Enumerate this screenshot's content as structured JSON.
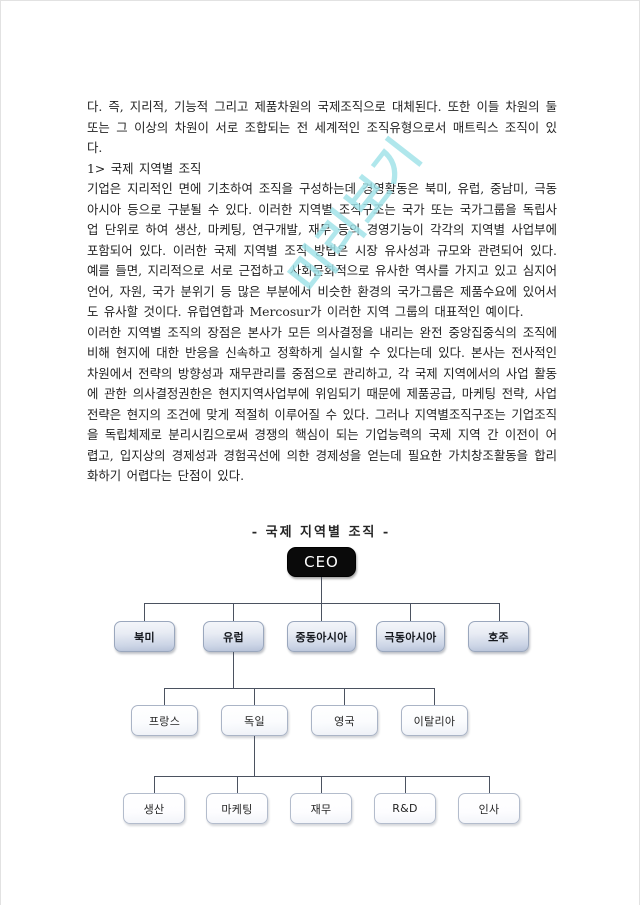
{
  "document": {
    "paragraphs": [
      {
        "id": "intro",
        "text": "다. 즉, 지리적, 기능적 그리고 제품차원의 국제조직으로 대체된다. 또한 이들 차원의 둘 또는 그 이상의 차원이 서로 조합되는 전 세계적인 조직유형으로서 매트릭스 조직이 있다."
      },
      {
        "id": "section-heading",
        "text": "1> 국제 지역별 조직"
      },
      {
        "id": "body-1",
        "text": "기업은 지리적인 면에 기초하여 조직을 구성하는데 경영활동은 북미, 유럽, 중남미, 극동아시아 등으로 구분될 수 있다. 이러한 지역별 조직구조는 국가 또는 국가그룹을 독립사업 단위로 하여 생산, 마케팅, 연구개발, 재무 등의 경영기능이 각각의 지역별 사업부에 포함되어 있다. 이러한 국제 지역별 조직 방법은 시장 유사성과 규모와 관련되어 있다. 예를 들면, 지리적으로 서로 근접하고 사회문화적으로 유사한 역사를 가지고 있고 심지어 언어, 자원, 국가 분위기 등 많은 부분에서 비슷한 환경의 국가그룹은 제품수요에 있어서도 유사할 것이다. 유럽연합과 Mercosur가 이러한 지역 그룹의 대표적인 예이다."
      },
      {
        "id": "body-2",
        "text": "이러한 지역별 조직의 장점은 본사가 모든 의사결정을 내리는 완전 중앙집중식의 조직에 비해 현지에 대한 반응을 신속하고 정확하게 실시할 수 있다는데 있다. 본사는 전사적인 차원에서 전략의 방향성과 재무관리를 중점으로 관리하고, 각 국제 지역에서의 사업 활동에 관한 의사결정권한은 현지지역사업부에 위임되기 때문에 제품공급, 마케팅 전략, 사업전략은 현지의 조건에 맞게 적절히 이루어질 수 있다. 그러나 지역별조직구조는 기업조직을 독립체제로 분리시킴으로써 경쟁의 핵심이 되는 기업능력의 국제 지역 간 이전이 어렵고, 입지상의 경제성과 경험곡선에 의한 경제성을 얻는데 필요한 가치창조활동을 합리화하기 어렵다는 단점이 있다."
      }
    ]
  },
  "watermark": {
    "text": "미리보기",
    "color": "#9fe2e8"
  },
  "chart": {
    "title": "- 국제 지역별 조직 -",
    "root": {
      "label": "CEO"
    },
    "regions": [
      {
        "label": "북미"
      },
      {
        "label": "유럽"
      },
      {
        "label": "중동아시아"
      },
      {
        "label": "극동아시아"
      },
      {
        "label": "호주"
      }
    ],
    "countries": [
      {
        "label": "프랑스"
      },
      {
        "label": "독일"
      },
      {
        "label": "영국"
      },
      {
        "label": "이탈리아"
      }
    ],
    "functions": [
      {
        "label": "생산"
      },
      {
        "label": "마케팅"
      },
      {
        "label": "재무"
      },
      {
        "label": "R&D"
      },
      {
        "label": "인사"
      }
    ]
  }
}
